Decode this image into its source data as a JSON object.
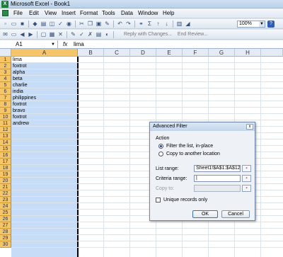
{
  "window": {
    "title": "Microsoft Excel - Book1",
    "app_icon": "X"
  },
  "menu": [
    "File",
    "Edit",
    "View",
    "Insert",
    "Format",
    "Tools",
    "Data",
    "Window",
    "Help"
  ],
  "toolbar": {
    "zoom": "100%",
    "reply_label": "Reply with Changes...",
    "end_review_label": "End Review...",
    "help_icon": "?"
  },
  "formula_bar": {
    "name_box": "A1",
    "fx": "fx",
    "content": "lima"
  },
  "columns": [
    "A",
    "B",
    "C",
    "D",
    "E",
    "F",
    "G",
    "H"
  ],
  "rows": [
    "1",
    "2",
    "3",
    "4",
    "5",
    "6",
    "7",
    "8",
    "9",
    "10",
    "11",
    "12",
    "13",
    "14",
    "15",
    "16",
    "17",
    "18",
    "19",
    "20",
    "21",
    "22",
    "23",
    "24",
    "25",
    "26",
    "27",
    "28",
    "29",
    "30"
  ],
  "cells": [
    "lima",
    "foxtrot",
    "alpha",
    "beta",
    "charlie",
    "india",
    "philippines",
    "foxtrot",
    "bravo",
    "foxtrot",
    "andrew"
  ],
  "dialog": {
    "title": "Advanced Filter",
    "close": "x",
    "action_label": "Action",
    "option_in_place": "Filter the list, in-place",
    "option_copy": "Copy to another location",
    "list_range_label": "List range:",
    "list_range_value": "Sheet1!$A$1:$A$12",
    "criteria_label": "Criteria range:",
    "criteria_value": "|",
    "copy_to_label": "Copy to:",
    "copy_to_value": "",
    "unique_label": "Unique records only",
    "ok": "OK",
    "cancel": "Cancel"
  }
}
